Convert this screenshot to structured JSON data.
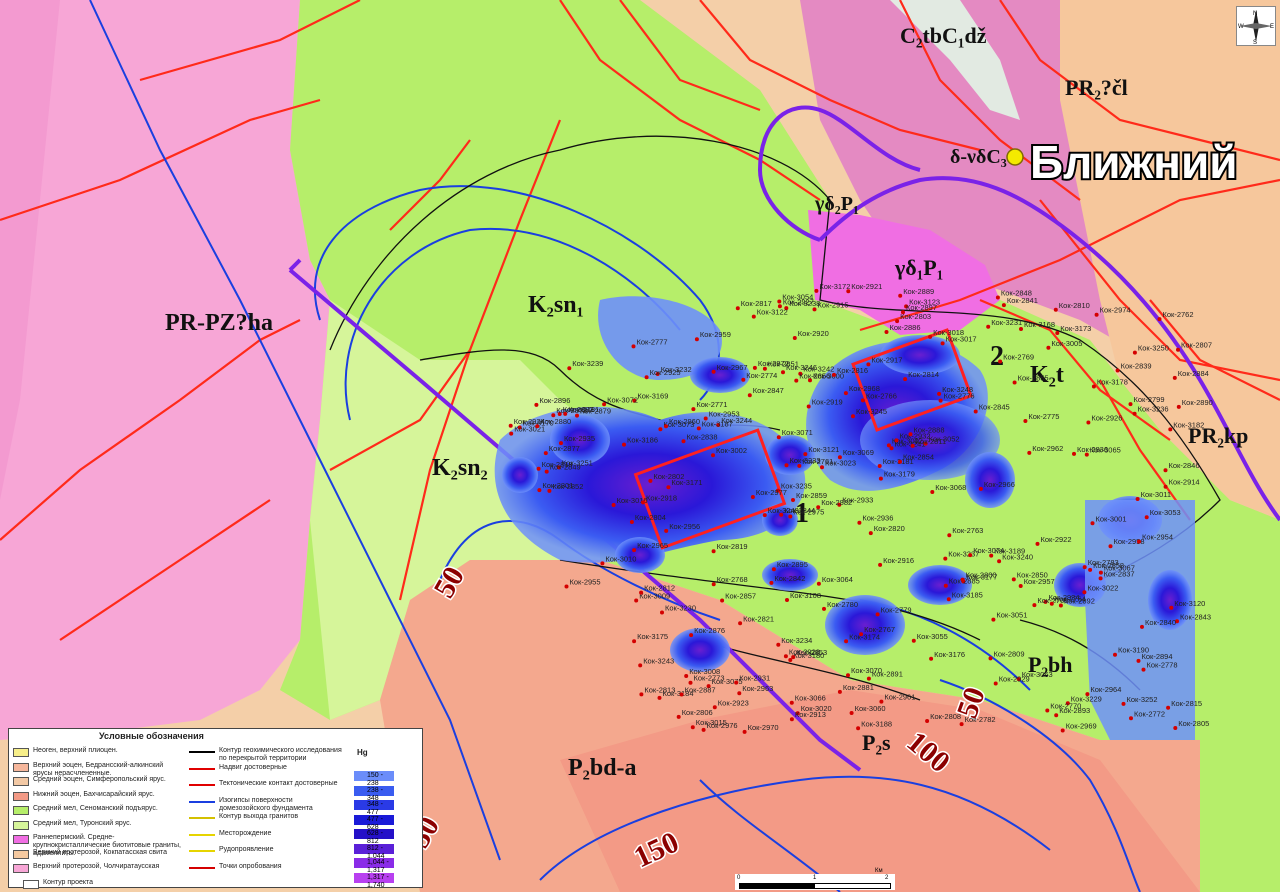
{
  "map": {
    "deposit_label": "Ближний",
    "contour_labels": [
      "50",
      "50",
      "100",
      "150",
      "50"
    ],
    "zone_labels": {
      "main_west": "PR-PZ?ha",
      "k2sn1": "K₂sn₁",
      "k2sn2": "K₂sn₂",
      "k2t": "K₂t",
      "pr2kp": "PR₂kp",
      "pr2cl": "PR₂?čl",
      "c2tb": "C₂tbC₁dž",
      "gd2p1": "γδ₂P₁",
      "gd1p1": "γδ₁P₁",
      "dvd": "δ-νδC₃",
      "p2bd": "P₂bd-a",
      "p2s": "P₂s",
      "p2bh": "P₂bh"
    },
    "box_labels": [
      "1",
      "2"
    ],
    "sample_points": [
      "Кок-3252",
      "Кок-3251",
      "Кок-3250",
      "Кок-3249",
      "Кок-3248",
      "Кок-3246",
      "Кок-3245",
      "Кок-3244",
      "Кок-3243",
      "Кок-3242",
      "Кок-3241",
      "Кок-3240",
      "Кок-3239",
      "Кок-3238",
      "Кок-3237",
      "Кок-3236",
      "Кок-3235",
      "Кок-3234",
      "Кок-3233",
      "Кок-3232",
      "Кок-3231",
      "Кок-3230",
      "Кок-3229",
      "Кок-3190",
      "Кок-3189",
      "Кок-3188",
      "Кок-3187",
      "Кок-3186",
      "Кок-3185",
      "Кок-3184",
      "Кок-3182",
      "Кок-3181",
      "Кок-3180",
      "Кок-3179",
      "Кок-3178",
      "Кок-3177",
      "Кок-3176",
      "Кок-3175",
      "Кок-3174",
      "Кок-3173",
      "Кок-3172",
      "Кок-3171",
      "Кок-3170",
      "Кок-3169",
      "Кок-3168",
      "Кок-3123",
      "Кок-3122",
      "Кок-3121",
      "Кок-3120",
      "Кок-3108",
      "Кок-3075",
      "Кок-3074",
      "Кок-3073",
      "Кок-3072",
      "Кок-3071",
      "Кок-3070",
      "Кок-3069",
      "Кок-3068",
      "Кок-3067",
      "Кок-3066",
      "Кок-3065",
      "Кок-3064",
      "Кок-3063",
      "Кок-3060",
      "Кок-3055",
      "Кок-3054",
      "Кок-3053",
      "Кок-3052",
      "Кок-3051",
      "Кок-3023",
      "Кок-3022",
      "Кок-3021",
      "Кок-3020",
      "Кок-3018",
      "Кок-3017",
      "Кок-3016",
      "Кок-3015",
      "Кок-3011",
      "Кок-3010",
      "Кок-3009",
      "Кок-3008",
      "Кок-3007",
      "Кок-3005",
      "Кок-3002",
      "Кок-3001",
      "Кок-3000",
      "Кок-2977",
      "Кок-2976",
      "Кок-2975",
      "Кок-2974",
      "Кок-2972",
      "Кок-2970",
      "Кок-2969",
      "Кок-2968",
      "Кок-2967",
      "Кок-2966",
      "Кок-2965",
      "Кок-2964",
      "Кок-2963",
      "Кок-2962",
      "Кок-2961",
      "Кок-2960",
      "Кок-2959",
      "Кок-2958",
      "Кок-2957",
      "Кок-2956",
      "Кок-2955",
      "Кок-2954",
      "Кок-2953",
      "Кок-2936",
      "Кок-2935",
      "Кок-2934",
      "Кок-2933",
      "Кок-2932",
      "Кок-2931",
      "Кок-2929",
      "Кок-2928",
      "Кок-2927",
      "Кок-2926",
      "Кок-2925",
      "Кок-2924",
      "Кок-2923",
      "Кок-2922",
      "Кок-2921",
      "Кок-2920",
      "Кок-2919",
      "Кок-2918",
      "Кок-2917",
      "Кок-2916",
      "Кок-2915",
      "Кок-2914",
      "Кок-2913",
      "Кок-2897",
      "Кок-2896",
      "Кок-2895",
      "Кок-2894",
      "Кок-2893",
      "Кок-2892",
      "Кок-2891",
      "Кок-2890",
      "Кок-2889",
      "Кок-2888",
      "Кок-2887",
      "Кок-2886",
      "Кок-2885",
      "Кок-2884",
      "Кок-2883",
      "Кок-2882",
      "Кок-2881",
      "Кок-2880",
      "Кок-2879",
      "Кок-2878",
      "Кок-2877",
      "Кок-2876",
      "Кок-2859",
      "Кок-2858",
      "Кок-2857",
      "Кок-2856",
      "Кок-2855",
      "Кок-2854",
      "Кок-2853",
      "Кок-2852",
      "Кок-2851",
      "Кок-2850",
      "Кок-2849",
      "Кок-2848",
      "Кок-2847",
      "Кок-2846",
      "Кок-2845",
      "Кок-2844",
      "Кок-2843",
      "Кок-2842",
      "Кок-2841",
      "Кок-2840",
      "Кок-2839",
      "Кок-2838",
      "Кок-2837",
      "Кок-2836",
      "Кок-2821",
      "Кок-2820",
      "Кок-2819",
      "Кок-2818",
      "Кок-2817",
      "Кок-2816",
      "Кок-2815",
      "Кок-2814",
      "Кок-2813",
      "Кок-2812",
      "Кок-2811",
      "Кок-2810",
      "Кок-2809",
      "Кок-2808",
      "Кок-2807",
      "Кок-2806",
      "Кок-2805",
      "Кок-2804",
      "Кок-2803",
      "Кок-2802",
      "Кок-2801",
      "Кок-2800",
      "Кок-2799",
      "Кок-2783",
      "Кок-2782",
      "Кок-2781",
      "Кок-2780",
      "Кок-2779",
      "Кок-2778",
      "Кок-2777",
      "Кок-2776",
      "Кок-2775",
      "Кок-2774",
      "Кок-2773",
      "Кок-2772",
      "Кок-2771",
      "Кок-2770",
      "Кок-2769",
      "Кок-2768",
      "Кок-2767",
      "Кок-2766",
      "Кок-2765",
      "Кок-2764",
      "Кок-2763",
      "Кок-2762",
      "Кок-2761"
    ]
  },
  "legend": {
    "title": "Условные обозначения",
    "units": [
      {
        "color": "#f7ef8a",
        "text": "Неоген, верхний плиоцен."
      },
      {
        "color": "#f6b79c",
        "text": "Верхний эоцен, Бедрансский-алкинский ярусы нерасчлененные."
      },
      {
        "color": "#f3c9a5",
        "text": "Средний эоцен, Симферопольский ярус."
      },
      {
        "color": "#f39a86",
        "text": "Нижний эоцен, Бахчисарайский ярус."
      },
      {
        "color": "#b6ee6a",
        "text": "Средний мел, Сеноманский подъярус."
      },
      {
        "color": "#d6f59a",
        "text": "Средний мел, Туронский ярус."
      },
      {
        "color": "#f06ee3",
        "text": "Раннепермский. Средне-крупнокристаллические биотитовые граниты, адамеллиты."
      },
      {
        "color": "#f5c9a0",
        "text": "Верхний протерозой, Кокпатасская свита"
      },
      {
        "color": "#f7a6d6",
        "text": "Верхний протерозой, Чолчиратаусская"
      }
    ],
    "lines": [
      {
        "text": "Контур геохимического исследования по перекрытой территории",
        "color": "#000000"
      },
      {
        "text": "Надвиг достоверные",
        "color": "#e00000"
      },
      {
        "text": "Тектонические контакт достоверные",
        "color": "#e00000"
      },
      {
        "text": "Изогипсы поверхности домезозойского фундамента",
        "color": "#1a3fe0"
      },
      {
        "text": "Контур выхода гранитов",
        "color": "#d4c000"
      },
      {
        "text": "Месторождение",
        "color": "#e6d400"
      },
      {
        "text": "Рудопроявление",
        "color": "#e6d400"
      },
      {
        "text": "Точки опробования",
        "color": "#d40000"
      }
    ],
    "hg_title": "Hg",
    "hg_classes": [
      {
        "color": "#6b8dfa",
        "range": "150 - 238"
      },
      {
        "color": "#3a5cf0",
        "range": "238 - 348"
      },
      {
        "color": "#2a3ae6",
        "range": "348 - 477"
      },
      {
        "color": "#1a1ad8",
        "range": "477 - 628"
      },
      {
        "color": "#2410c8",
        "range": "628 - 812"
      },
      {
        "color": "#5a20d8",
        "range": "812 - 1,044"
      },
      {
        "color": "#8a2ce8",
        "range": "1,044 - 1,317"
      },
      {
        "color": "#b840f0",
        "range": "1,317 - 1,740"
      }
    ],
    "bottom_item": "Контур проекта"
  },
  "scale": {
    "unit": "Км",
    "ticks": [
      "0",
      "1",
      "2"
    ]
  },
  "compass": {
    "n": "N",
    "s": "S",
    "e": "E",
    "w": "W"
  }
}
